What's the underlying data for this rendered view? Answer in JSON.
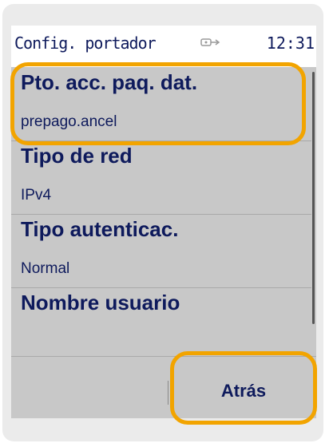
{
  "status_bar": {
    "title": "Config. portador",
    "status_icon": "connection-icon",
    "time": "12:31"
  },
  "settings": {
    "items": [
      {
        "label": "Pto. acc. paq. dat.",
        "value": "prepago.ancel"
      },
      {
        "label": "Tipo de red",
        "value": "IPv4"
      },
      {
        "label": "Tipo autenticac.",
        "value": "Normal"
      },
      {
        "label": "Nombre usuario",
        "value": ""
      }
    ]
  },
  "softkeys": {
    "right_label": "Atrás"
  },
  "colors": {
    "text": "#0e1a5c",
    "highlight": "#f2a400",
    "list_background": "#c8c8c8"
  }
}
